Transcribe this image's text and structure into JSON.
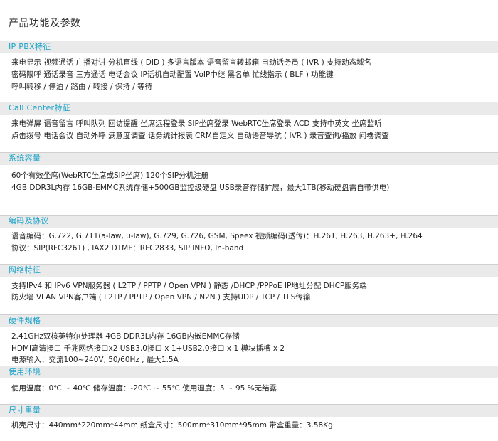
{
  "page_title": "产品功能及参数",
  "accent_color": "#1aa3c8",
  "sections": [
    {
      "title": "IP PBX特征",
      "lines": [
        "来电显示   视频通话   广播对讲   分机直线 ( DID )   多语言版本   语音留言转邮箱   自动话务员 ( IVR )   支持动态域名",
        "密码限呼   通话录音   三方通话   电话会议   IP话机自动配置   VoIP中继   黑名单   忙线指示 ( BLF )   功能键",
        "呼叫转移 / 停泊 / 路由 / 转接 / 保持 / 等待"
      ]
    },
    {
      "title": "Call Center特征",
      "lines": [
        "来电弹屏   语音留言   呼叫队列   回访提醒   坐席远程登录   SIP坐席登录   WebRTC坐席登录   ACD   支持中英文   坐席监听",
        "点击拨号   电话会议   自动外呼   满意度调查   话务统计报表   CRM自定义   自动语音导航 ( IVR )   录音查询/播放   问卷调查"
      ]
    },
    {
      "title": "系统容量",
      "lines": [
        "60个有效坐席(WebRTC坐席或SIP坐席)   120个SIP分机注册",
        "4GB DDR3L内存   16GB-EMMC系统存储+500GB监控级硬盘   USB录音存储扩展，最大1TB(移动硬盘需自带供电)"
      ]
    },
    {
      "title": "编码及协议",
      "lines": [
        "语音编码：G.722,  G.711(a-law,  u-law),  G.729,  G.726,  GSM,  Speex   视频编码(透传)：H.261,  H.263,  H.263+,  H.264",
        "协议：SIP(RFC3261) , IAX2   DTMF：RFC2833,  SIP   INFO,  In-band"
      ]
    },
    {
      "title": "网络特征",
      "lines": [
        "支持IPv4 和 IPv6   VPN服务器 ( L2TP / PPTP / Open VPN )   静态 /DHCP /PPPoE IP地址分配   DHCP服务端",
        "防火墙   VLAN   VPN客户端 ( L2TP / PPTP / Open VPN / N2N )   支持UDP / TCP / TLS传输"
      ]
    },
    {
      "title": "硬件规格",
      "lines": [
        "2.41GHz双核英特尔处理器   4GB DDR3L内存   16GB内嵌EMMC存储",
        "HDMI高清接口   千兆网络接口x2   USB3.0接口 x 1+USB2.0接口 x 1   模块插槽 x 2",
        "电源输入：交流100~240V,  50/60Hz , 最大1.5A"
      ]
    },
    {
      "title": "使用环境",
      "lines": [
        "使用温度：0℃ ~ 40℃   储存温度：-20℃ ~ 55℃   使用湿度：5 ~ 95 %无结露"
      ]
    },
    {
      "title": "尺寸重量",
      "lines": [
        "机壳尺寸：440mm*220mm*44mm   纸盒尺寸：500mm*310mm*95mm   带盒重量：3.58Kg"
      ]
    }
  ]
}
